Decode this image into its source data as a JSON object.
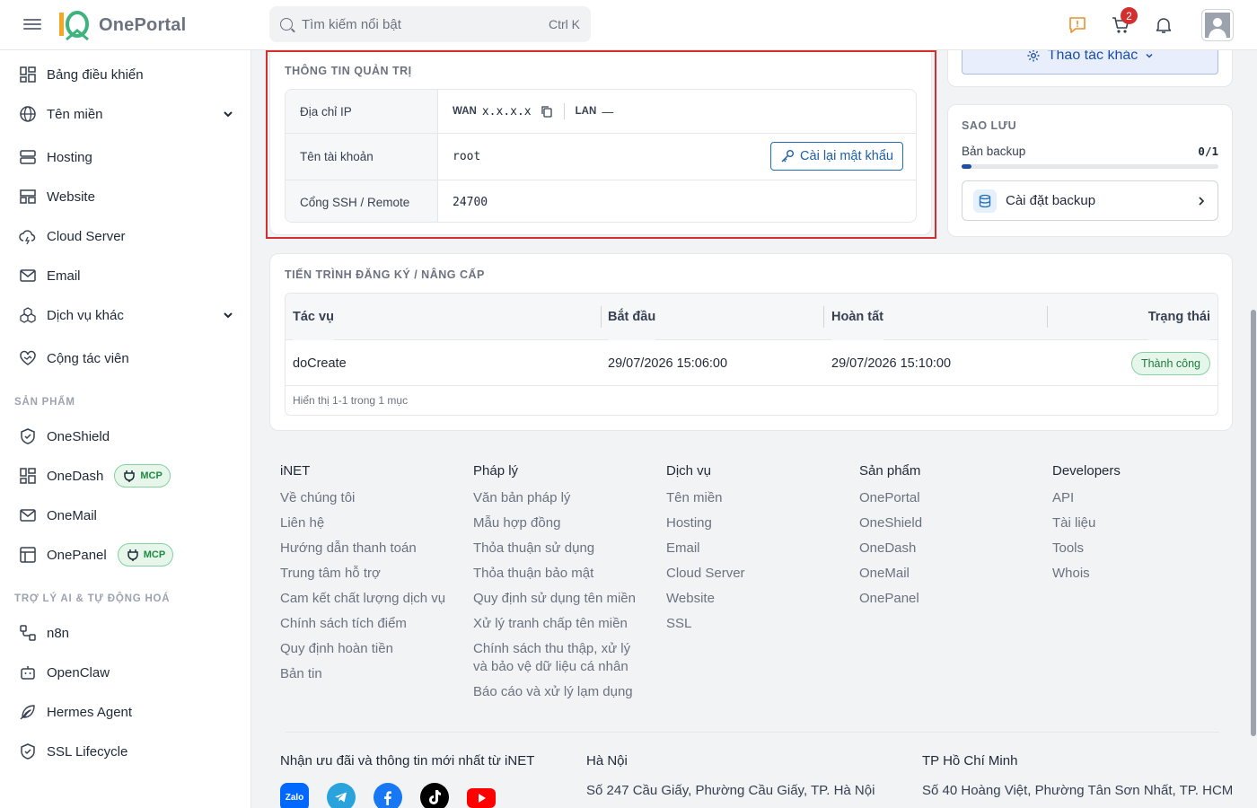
{
  "header": {
    "logo_text": "OnePortal",
    "search_placeholder": "Tìm kiếm nổi bật",
    "search_shortcut": "Ctrl K",
    "cart_count": "2"
  },
  "sidebar": {
    "items": [
      {
        "label": "Bảng điều khiển"
      },
      {
        "label": "Tên miền"
      },
      {
        "label": "Hosting"
      },
      {
        "label": "Website"
      },
      {
        "label": "Cloud Server"
      },
      {
        "label": "Email"
      },
      {
        "label": "Dịch vụ khác"
      },
      {
        "label": "Cộng tác viên"
      }
    ],
    "section_products": "SẢN PHẨM",
    "products": [
      {
        "label": "OneShield"
      },
      {
        "label": "OneDash",
        "badge": "MCP"
      },
      {
        "label": "OneMail"
      },
      {
        "label": "OnePanel",
        "badge": "MCP"
      }
    ],
    "section_ai": "TRỢ LÝ AI & TỰ ĐỘNG HOÁ",
    "ai_items": [
      {
        "label": "n8n"
      },
      {
        "label": "OpenClaw"
      },
      {
        "label": "Hermes Agent"
      },
      {
        "label": "SSL Lifecycle"
      }
    ]
  },
  "admin_info": {
    "title": "THÔNG TIN QUẢN TRỊ",
    "ip_label": "Địa chỉ IP",
    "wan_tag": "WAN",
    "wan_value": "x.x.x.x",
    "lan_tag": "LAN",
    "lan_value": "—",
    "account_label": "Tên tài khoản",
    "account_value": "root",
    "reset_button": "Cài lại mật khẩu",
    "ssh_label": "Cổng SSH / Remote",
    "ssh_value": "24700"
  },
  "actions": {
    "more_button": "Thao tác khác"
  },
  "backup": {
    "title": "SAO LƯU",
    "label": "Bản backup",
    "count": "0/1",
    "progress": 0.04,
    "setup_label": "Cài đặt backup"
  },
  "process": {
    "title": "TIẾN TRÌNH ĐĂNG KÝ / NÂNG CẤP",
    "columns": [
      "Tác vụ",
      "Bắt đầu",
      "Hoàn tất",
      "Trạng thái"
    ],
    "rows": [
      {
        "task": "doCreate",
        "start": "29/07/2026 15:06:00",
        "end": "29/07/2026 15:10:00",
        "status": "Thành công"
      }
    ],
    "footer": "Hiển thị 1-1 trong 1 mục"
  },
  "footer": {
    "columns": [
      {
        "title": "iNET",
        "links": [
          "Về chúng tôi",
          "Liên hệ",
          "Hướng dẫn thanh toán",
          "Trung tâm hỗ trợ",
          "Cam kết chất lượng dịch vụ",
          "Chính sách tích điểm",
          "Quy định hoàn tiền",
          "Bản tin"
        ]
      },
      {
        "title": "Pháp lý",
        "links": [
          "Văn bản pháp lý",
          "Mẫu hợp đồng",
          "Thỏa thuận sử dụng",
          "Thỏa thuận bảo mật",
          "Quy định sử dụng tên miền",
          "Xử lý tranh chấp tên miền",
          "Chính sách thu thập, xử lý và bảo vệ dữ liệu cá nhân",
          "Báo cáo và xử lý lạm dụng"
        ]
      },
      {
        "title": "Dịch vụ",
        "links": [
          "Tên miền",
          "Hosting",
          "Email",
          "Cloud Server",
          "Website",
          "SSL"
        ]
      },
      {
        "title": "Sản phẩm",
        "links": [
          "OnePortal",
          "OneShield",
          "OneDash",
          "OneMail",
          "OnePanel"
        ]
      },
      {
        "title": "Developers",
        "links": [
          "API",
          "Tài liệu",
          "Tools",
          "Whois"
        ]
      }
    ],
    "newsletter": "Nhận ưu đãi và thông tin mới nhất từ iNET",
    "hanoi_title": "Hà Nội",
    "hanoi_address": "Số 247 Cầu Giấy, Phường Cầu Giấy, TP. Hà Nội",
    "hcm_title": "TP Hồ Chí Minh",
    "hcm_address": "Số 40 Hoàng Việt, Phường Tân Sơn Nhất, TP. HCM",
    "social": [
      "Zalo"
    ]
  },
  "colors": {
    "accent": "#1e4fa3",
    "highlight": "#d32f2f",
    "success": "#1f7a3c"
  }
}
